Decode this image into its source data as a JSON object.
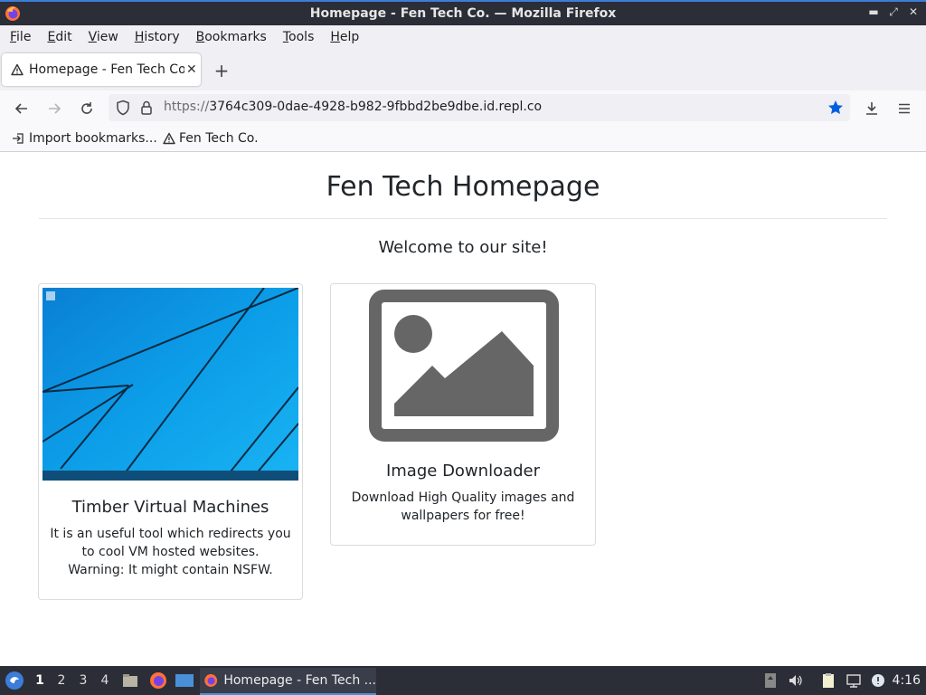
{
  "window": {
    "title": "Homepage - Fen Tech Co. — Mozilla Firefox"
  },
  "menubar": {
    "items": [
      {
        "label": "File",
        "u": "F",
        "rest": "ile"
      },
      {
        "label": "Edit",
        "u": "E",
        "rest": "dit"
      },
      {
        "label": "View",
        "u": "V",
        "rest": "iew"
      },
      {
        "label": "History",
        "u": "H",
        "rest": "istory"
      },
      {
        "label": "Bookmarks",
        "u": "B",
        "rest": "ookmarks"
      },
      {
        "label": "Tools",
        "u": "T",
        "rest": "ools"
      },
      {
        "label": "Help",
        "u": "H",
        "rest": "elp"
      }
    ]
  },
  "tabs": [
    {
      "label": "Homepage - Fen Tech Co.",
      "active": true
    }
  ],
  "navbar": {
    "url_proto": "https://",
    "url_rest": "3764c309-0dae-4928-b982-9fbbd2be9dbe.id.repl.co"
  },
  "bookmarks": {
    "items": [
      {
        "label": "Import bookmarks..."
      },
      {
        "label": "Fen Tech Co."
      }
    ]
  },
  "page": {
    "title": "Fen Tech Homepage",
    "welcome": "Welcome to our site!",
    "cards": [
      {
        "title": "Timber Virtual Machines",
        "text": "It is an useful tool which redirects you to cool VM hosted websites.",
        "warning": "Warning: It might contain NSFW."
      },
      {
        "title": "Image Downloader",
        "text": "Download High Quality images and wallpapers for free!"
      }
    ]
  },
  "taskbar": {
    "workspaces": [
      "1",
      "2",
      "3",
      "4"
    ],
    "active_workspace": "1",
    "task_label": "Homepage - Fen Tech ...",
    "clock": "4:16"
  },
  "colors": {
    "accent": "#4a90d9",
    "star": "#0060df",
    "placeholder_gray": "#666666"
  }
}
